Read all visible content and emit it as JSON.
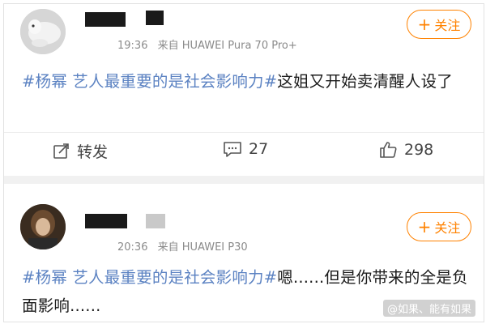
{
  "posts": [
    {
      "time": "19:36",
      "source": "来自 HUAWEI Pura 70 Pro+",
      "follow_label": "关注",
      "hashtag": "#杨幂 艺人最重要的是社会影响力#",
      "text": "这姐又开始卖清醒人设了",
      "repost_label": "转发",
      "comment_count": "27",
      "like_count": "298"
    },
    {
      "time": "20:36",
      "source": "来自 HUAWEI P30",
      "follow_label": "关注",
      "hashtag": "#杨幂 艺人最重要的是社会影响力#",
      "text": "嗯......但是你带来的全是负面影响......"
    }
  ],
  "watermark": "@如果、能有如果",
  "colors": {
    "accent": "#ff8200",
    "hashtag": "#5b82c2"
  }
}
